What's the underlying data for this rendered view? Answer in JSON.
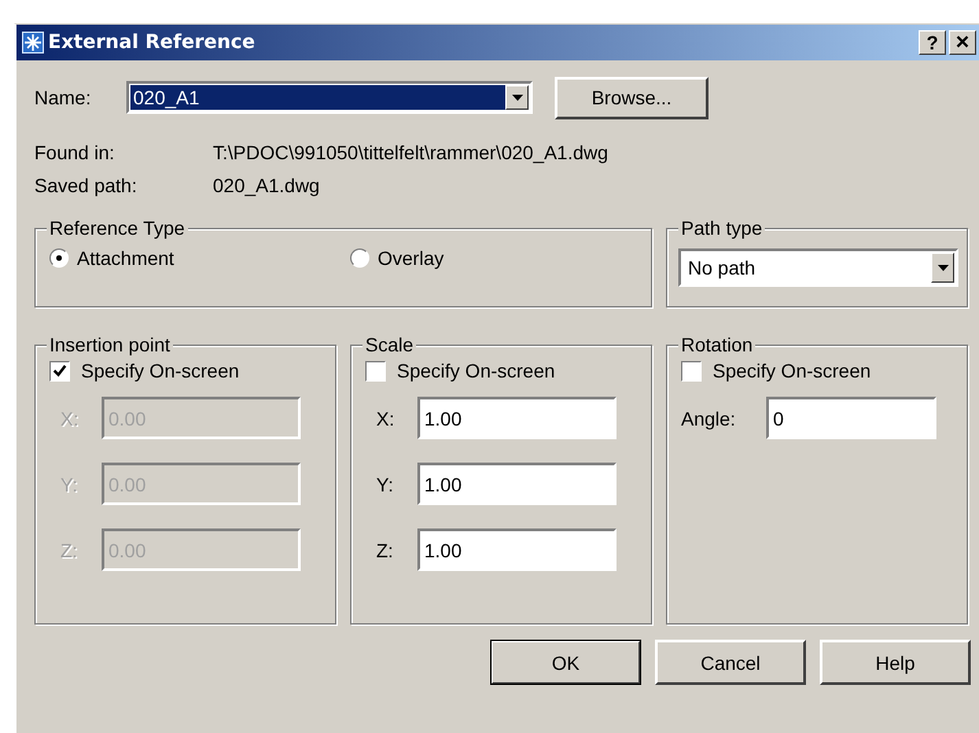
{
  "window": {
    "title": "External Reference",
    "controls": [
      {
        "kind": "help",
        "label": "?"
      },
      {
        "kind": "close",
        "label": "×"
      }
    ]
  },
  "name_field": {
    "label": "Name:",
    "value": "020_A1",
    "selected": true
  },
  "browse_button": {
    "label": "Browse..."
  },
  "info": [
    {
      "label": "Found in:",
      "value": "T:\\PDOC\\991050\\tittelfelt\\rammer\\020_A1.dwg"
    },
    {
      "label": "Saved path:",
      "value": "020_A1.dwg"
    }
  ],
  "reference_type": {
    "title": "Reference Type",
    "options": [
      {
        "label": "Attachment",
        "selected": true
      },
      {
        "label": "Overlay",
        "selected": false
      }
    ]
  },
  "path_type": {
    "title": "Path type",
    "value": "No path"
  },
  "groups": [
    {
      "title": "Insertion point",
      "checkbox": {
        "label": "Specify On-screen",
        "checked": true
      },
      "fields": [
        {
          "label": "X:",
          "value": "0.00",
          "disabled": true
        },
        {
          "label": "Y:",
          "value": "0.00",
          "disabled": true
        },
        {
          "label": "Z:",
          "value": "0.00",
          "disabled": true
        }
      ]
    },
    {
      "title": "Scale",
      "checkbox": {
        "label": "Specify On-screen",
        "checked": false
      },
      "fields": [
        {
          "label": "X:",
          "value": "1.00",
          "disabled": false
        },
        {
          "label": "Y:",
          "value": "1.00",
          "disabled": false
        },
        {
          "label": "Z:",
          "value": "1.00",
          "disabled": false
        }
      ]
    },
    {
      "title": "Rotation",
      "checkbox": {
        "label": "Specify On-screen",
        "checked": false
      },
      "fields": [
        {
          "label": "Angle:",
          "value": "0",
          "disabled": false
        }
      ]
    }
  ],
  "buttons": [
    {
      "label": "OK",
      "default": true
    },
    {
      "label": "Cancel",
      "default": false
    },
    {
      "label": "Help",
      "default": false
    }
  ]
}
